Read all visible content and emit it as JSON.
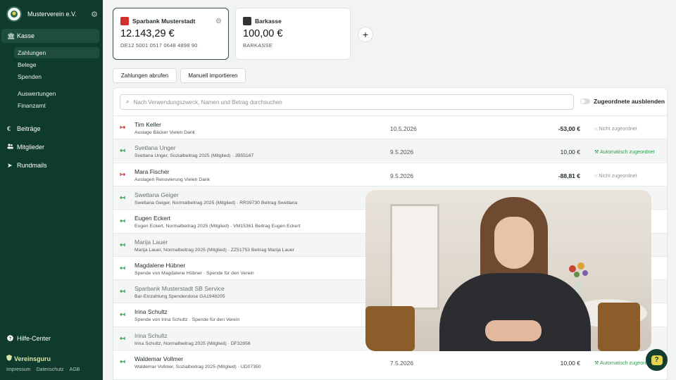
{
  "sidebar": {
    "org_name": "Musterverein e.V.",
    "icons": {
      "org": "crest-logo",
      "settings": "gear-icon"
    },
    "main_item": {
      "label": "Kasse",
      "icon": "bank-icon"
    },
    "sub_items": [
      {
        "label": "Zahlungen",
        "active": true
      },
      {
        "label": "Belege"
      },
      {
        "label": "Spenden"
      },
      {
        "label": "Auswertungen"
      },
      {
        "label": "Finanzamt"
      }
    ],
    "top_items": [
      {
        "label": "Beiträge",
        "icon": "euro-icon",
        "glyph": "€"
      },
      {
        "label": "Mitglieder",
        "icon": "members-icon",
        "glyph": "👥"
      },
      {
        "label": "Rundmails",
        "icon": "send-icon",
        "glyph": "➤"
      }
    ],
    "help": {
      "label": "Hilfe-Center",
      "icon": "help-icon"
    },
    "brand": "Vereinsguru",
    "footer_links": [
      "Impressum",
      "Datenschutz",
      "AGB"
    ]
  },
  "accounts": [
    {
      "name": "Sparbank Musterstadt",
      "amount": "12.143,29 €",
      "sub": "DE12 5001 0517 0648 4898 90",
      "icon": "bank-logo-icon",
      "color": "#d0312d"
    },
    {
      "name": "Barkasse",
      "amount": "100,00 €",
      "sub": "BARKASSE",
      "icon": "cash-icon",
      "color": "#333333"
    }
  ],
  "actions": {
    "fetch": "Zahlungen abrufen",
    "import": "Manuell importieren"
  },
  "search": {
    "placeholder": "Nach Verwendungszweck, Namen und Betrag durchsuchen"
  },
  "toggle": {
    "label": "Zugeordnete ausblenden"
  },
  "transactions": [
    {
      "dir": "out",
      "name": "Tim Keller",
      "desc": "Auslage Bäcker Vielen Dank",
      "date": "10.5.2026",
      "amount": "-53,00 €",
      "status": "Nicht zugeordnet",
      "status_type": "none"
    },
    {
      "dir": "in",
      "name": "Svetlana Unger",
      "desc": "Svetlana Unger, Sozialbeitrag 2025 (Mitglied) · JB55167",
      "date": "9.5.2026",
      "amount": "10,00 €",
      "status": "Automatisch zugeordnet",
      "status_type": "auto"
    },
    {
      "dir": "out",
      "name": "Mara Fischer",
      "desc": "Auslagen Renovierung Vielen Dank",
      "date": "9.5.2026",
      "amount": "-88,81 €",
      "status": "Nicht zugeordnet",
      "status_type": "none"
    },
    {
      "dir": "in",
      "name": "Swetlana Geiger",
      "desc": "Swetlana Geiger, Normalbeitrag 2025 (Mitglied) · RR39730 Beitrag Swetlana",
      "date": "",
      "amount": "",
      "status": "",
      "status_type": "auto"
    },
    {
      "dir": "in",
      "name": "Eugen Eckert",
      "desc": "Eugen Eckert, Normalbeitrag 2025 (Mitglied) · VM15361 Beitrag Eugen Eckert",
      "date": "",
      "amount": "",
      "status": "",
      "status_type": "auto"
    },
    {
      "dir": "in",
      "name": "Marija Lauer",
      "desc": "Marija Lauer, Normalbeitrag 2025 (Mitglied) · ZZ51753 Beitrag Marija Lauer",
      "date": "",
      "amount": "",
      "status": "",
      "status_type": "auto"
    },
    {
      "dir": "in",
      "name": "Magdalene Hübner",
      "desc": "Spende von Magdalene Hübner · Spende für den Verein",
      "date": "",
      "amount": "",
      "status": "",
      "status_type": "auto"
    },
    {
      "dir": "in",
      "name": "Sparbank Musterstadt SB Service",
      "desc": "Bar-Einzahlung Spendendose GA1948205",
      "date": "",
      "amount": "",
      "status": "",
      "status_type": "auto"
    },
    {
      "dir": "in",
      "name": "Irina Schultz",
      "desc": "Spende von Irina Schultz · Spende für den Verein",
      "date": "",
      "amount": "",
      "status": "",
      "status_type": "auto"
    },
    {
      "dir": "in",
      "name": "Irina Schultz",
      "desc": "Irina Schultz, Normalbeitrag 2025 (Mitglied) · DF32856",
      "date": "",
      "amount": "",
      "status": "",
      "status_type": "auto"
    },
    {
      "dir": "in",
      "name": "Waldemar Vollmer",
      "desc": "Waldemar Vollmer, Sozialbeitrag 2025 (Mitglied) · UD07350",
      "date": "7.5.2026",
      "amount": "10,00 €",
      "status": "Automatisch zugeordnet",
      "status_type": "auto"
    }
  ],
  "overlay": {
    "type": "video",
    "icon": "presenter-video"
  },
  "fab": {
    "icon": "chat-help-icon",
    "glyph": "?"
  }
}
